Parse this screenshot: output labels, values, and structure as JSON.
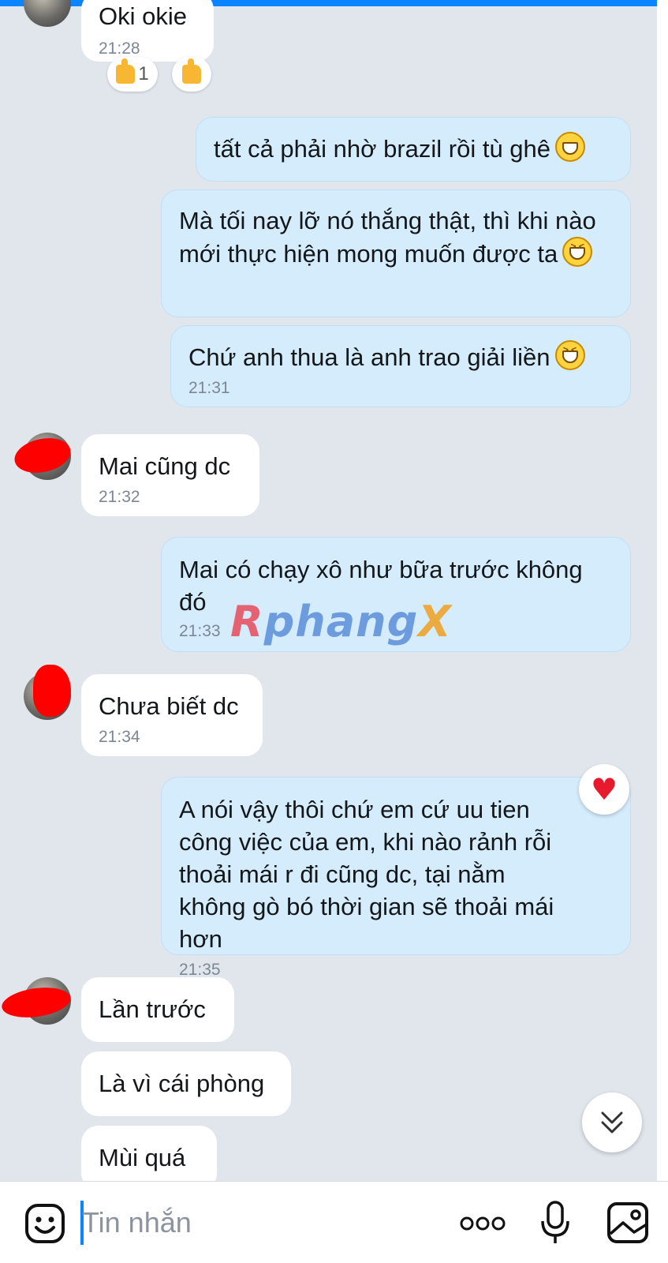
{
  "messages": [
    {
      "text": "Oki okie",
      "time": "21:28"
    },
    {
      "text": "tất cả phải nhờ brazil rồi tù ghê",
      "time": ""
    },
    {
      "text": "Mà tối nay lỡ nó thắng thật, thì khi nào mới thực hiện mong muốn được ta",
      "time": ""
    },
    {
      "text": "Chứ anh thua là anh trao giải liền",
      "time": "21:31"
    },
    {
      "text": "Mai cũng dc",
      "time": "21:32"
    },
    {
      "text": "Mai có chạy xô như bữa trước không đó",
      "time": "21:33"
    },
    {
      "text": "Chưa biết dc",
      "time": "21:34"
    },
    {
      "text": "A nói vậy thôi chứ em cứ uu tien công việc của em, khi nào rảnh rỗi thoải mái r đi cũng dc, tại nằm không gò bó thời gian sẽ thoải mái hơn",
      "time": "21:35"
    },
    {
      "text": "Lần trước",
      "time": ""
    },
    {
      "text": "Là vì cái phòng",
      "time": ""
    },
    {
      "text": "Mùi quá",
      "time": ""
    }
  ],
  "reactions": {
    "thumbs_count": "1"
  },
  "watermark": {
    "first": "R",
    "middle": "phang",
    "last": "X"
  },
  "composer": {
    "placeholder": "Tin nhắn"
  },
  "colors": {
    "accent": "#0a84ff",
    "outgoing_bubble": "#d5ecfd",
    "incoming_bubble": "#ffffff",
    "background": "#e1e6ed",
    "heart": "#e8192c"
  },
  "icons": [
    "sticker-icon",
    "more-icon",
    "microphone-icon",
    "image-icon",
    "chevron-double-down-icon",
    "heart-icon",
    "thumbs-up-icon",
    "grinning-emoji-icon",
    "laughing-emoji-icon"
  ]
}
